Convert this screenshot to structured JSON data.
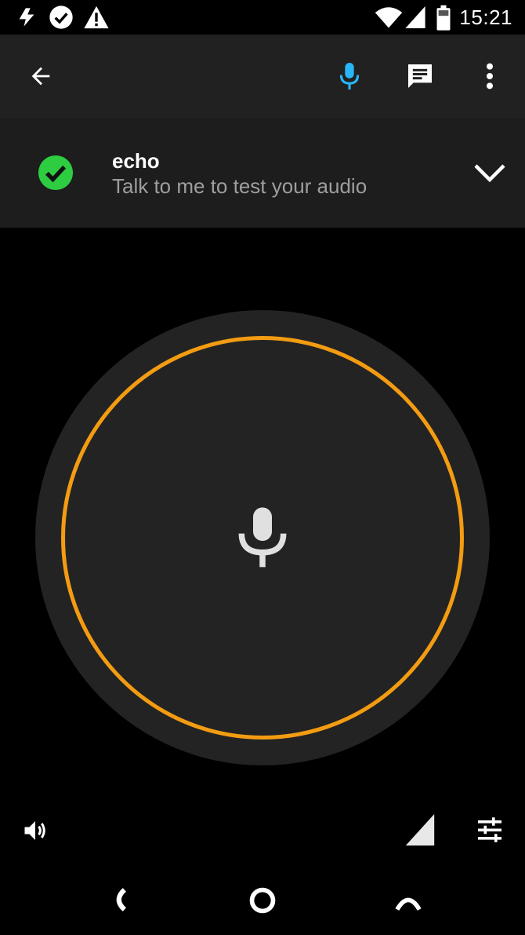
{
  "status_bar": {
    "time": "15:21",
    "left_icons": [
      "flash-icon",
      "check-circle-icon",
      "warning-icon"
    ],
    "right_icons": [
      "wifi-icon",
      "cell-signal-icon",
      "battery-icon"
    ]
  },
  "app_bar": {
    "back_icon": "arrow-back-icon",
    "actions": [
      "mic-icon",
      "chat-icon",
      "more-vert-icon"
    ],
    "accent_color": "#29b6f6"
  },
  "contact": {
    "name": "echo",
    "subtitle": "Talk to me to test your audio",
    "status_icon": "check-circle-icon",
    "status_color": "#2ecc40",
    "expand_icon": "chevron-down-icon"
  },
  "call_stage": {
    "ring_color": "#f39c12",
    "center_icon": "mic-icon"
  },
  "bottom_controls": [
    "volume-icon",
    "signal-quality-icon",
    "tune-icon"
  ],
  "nav_bar": [
    "back-nav-icon",
    "home-nav-icon",
    "recents-nav-icon"
  ]
}
